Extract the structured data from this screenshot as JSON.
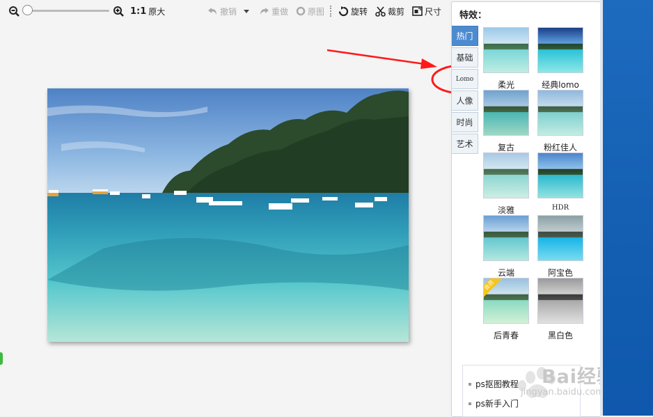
{
  "toolbar": {
    "zoom_out_icon": "zoom-out-icon",
    "zoom_in_icon": "zoom-in-icon",
    "zoom_ratio": "1:1",
    "original_size_label": "原大",
    "undo_label": "撤销",
    "redo_label": "重做",
    "original_label": "原图",
    "rotate_label": "旋转",
    "crop_label": "裁剪",
    "size_label": "尺寸"
  },
  "panel": {
    "title": "特效：",
    "tabs": [
      {
        "label": "热门",
        "active": true
      },
      {
        "label": "基础",
        "active": false
      },
      {
        "label": "Lomo",
        "active": false
      },
      {
        "label": "人像",
        "active": false
      },
      {
        "label": "时尚",
        "active": false
      },
      {
        "label": "艺术",
        "active": false
      }
    ],
    "effects": [
      {
        "label": "柔光"
      },
      {
        "label": "经典lomo"
      },
      {
        "label": "复古"
      },
      {
        "label": "粉红佳人"
      },
      {
        "label": "淡雅"
      },
      {
        "label": "HDR"
      },
      {
        "label": "云端"
      },
      {
        "label": "阿宝色"
      },
      {
        "label": "后青春",
        "badge": "会员"
      },
      {
        "label": "黑白色"
      }
    ]
  },
  "ad": {
    "items": [
      "ps抠图教程",
      "ps新手入门"
    ]
  },
  "watermark": {
    "text": "Bai经验",
    "url": "jingyan.baidu.com"
  },
  "colors": {
    "accent_tab": "#4d8bd0",
    "annotation_red": "#ff1a1a",
    "desktop_blue": "#1560b3"
  }
}
